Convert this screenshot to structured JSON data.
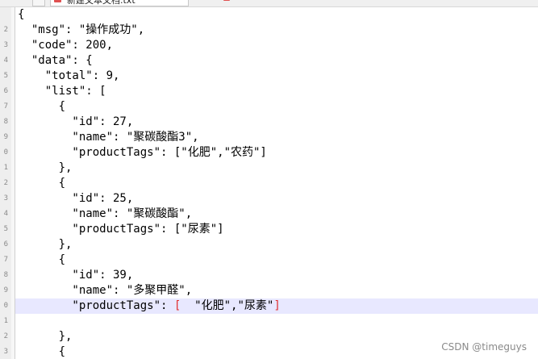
{
  "lines": [
    {
      "num": "",
      "text": "{"
    },
    {
      "num": "2",
      "text": "  \"msg\": \"操作成功\","
    },
    {
      "num": "3",
      "text": "  \"code\": 200,"
    },
    {
      "num": "4",
      "text": "  \"data\": {"
    },
    {
      "num": "5",
      "text": "    \"total\": 9,"
    },
    {
      "num": "6",
      "text": "    \"list\": ["
    },
    {
      "num": "7",
      "text": "      {"
    },
    {
      "num": "8",
      "text": "        \"id\": 27,"
    },
    {
      "num": "9",
      "text": "        \"name\": \"聚碳酸酯3\","
    },
    {
      "num": "0",
      "text": "        \"productTags\": [\"化肥\",\"农药\"]"
    },
    {
      "num": "1",
      "text": "      },"
    },
    {
      "num": "2",
      "text": "      {"
    },
    {
      "num": "3",
      "text": "        \"id\": 25,"
    },
    {
      "num": "4",
      "text": "        \"name\": \"聚碳酸酯\","
    },
    {
      "num": "5",
      "text": "        \"productTags\": [\"尿素\"]"
    },
    {
      "num": "6",
      "text": "      },"
    },
    {
      "num": "7",
      "text": "      {"
    },
    {
      "num": "8",
      "text": "        \"id\": 39,"
    },
    {
      "num": "9",
      "text": "        \"name\": \"多聚甲醛\","
    },
    {
      "num": "0",
      "text_before": "        \"productTags\": ",
      "text_bracket_open": "[",
      "text_middle": "  \"化肥\",\"尿素\"",
      "text_bracket_close": "]"
    },
    {
      "num": "1",
      "text": ""
    },
    {
      "num": "2",
      "text": "      },"
    },
    {
      "num": "3",
      "text": "      {"
    }
  ],
  "active_line_index": 19,
  "watermark": "CSDN @timeguys",
  "tab_title": "新建文本文档.txt"
}
